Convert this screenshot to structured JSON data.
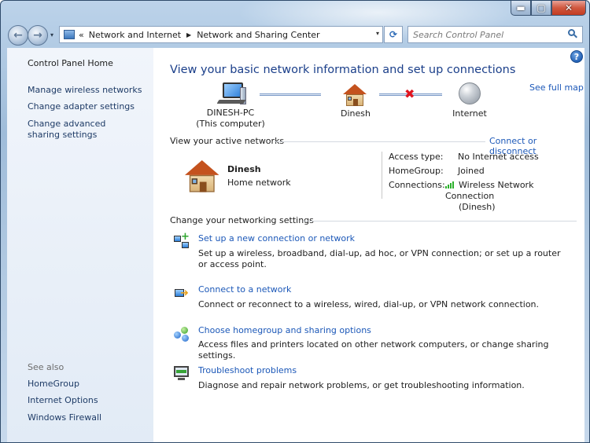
{
  "window": {
    "minimize_glyph": "▬",
    "maximize_glyph": "▢",
    "close_glyph": "✕"
  },
  "nav": {
    "back_glyph": "←",
    "forward_glyph": "→",
    "dropdown_glyph": "▾",
    "breadcrumb_overflow": "«",
    "breadcrumb": [
      "Network and Internet",
      "Network and Sharing Center"
    ],
    "breadcrumb_sep": "▶",
    "refresh_glyph": "⟳",
    "search_placeholder": "Search Control Panel"
  },
  "sidebar": {
    "home": "Control Panel Home",
    "items": [
      "Manage wireless networks",
      "Change adapter settings",
      "Change advanced sharing settings"
    ],
    "see_also_label": "See also",
    "see_also": [
      "HomeGroup",
      "Internet Options",
      "Windows Firewall"
    ]
  },
  "main": {
    "help_glyph": "?",
    "heading": "View your basic network information and set up connections",
    "see_full_map": "See full map",
    "map": {
      "computer_name": "DINESH-PC",
      "computer_sub": "(This computer)",
      "network_name": "Dinesh",
      "internet_label": "Internet",
      "broken_link_glyph": "✖"
    },
    "active_networks": {
      "title": "View your active networks",
      "connect_link": "Connect or disconnect",
      "network_name": "Dinesh",
      "network_type": "Home network",
      "access_type_label": "Access type:",
      "access_type_value": "No Internet access",
      "homegroup_label": "HomeGroup:",
      "homegroup_value": "Joined",
      "connections_label": "Connections:",
      "connections_value_line1": "Wireless Network Connection",
      "connections_value_line2": "(Dinesh)"
    },
    "settings": {
      "title": "Change your networking settings",
      "tasks": [
        {
          "title": "Set up a new connection or network",
          "desc": "Set up a wireless, broadband, dial-up, ad hoc, or VPN connection; or set up a router or access point."
        },
        {
          "title": "Connect to a network",
          "desc": "Connect or reconnect to a wireless, wired, dial-up, or VPN network connection."
        },
        {
          "title": "Choose homegroup and sharing options",
          "desc": "Access files and printers located on other network computers, or change sharing settings."
        },
        {
          "title": "Troubleshoot problems",
          "desc": "Diagnose and repair network problems, or get troubleshooting information."
        }
      ]
    }
  },
  "colors": {
    "link": "#1c58b8",
    "heading": "#1b3f8a",
    "error_x": "#e0141e",
    "signal": "#2bb02b"
  }
}
